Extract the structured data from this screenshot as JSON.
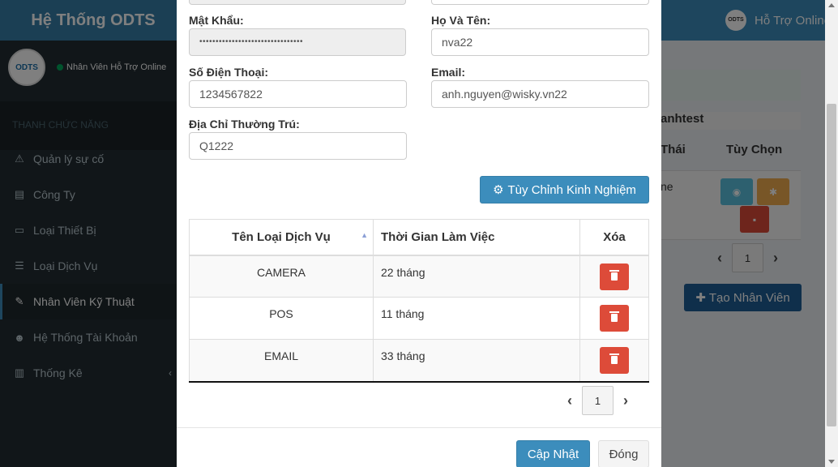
{
  "app": {
    "logo": "Hệ Thống ODTS",
    "help_online": "Hỗ Trợ Online",
    "help_avatar_text": "ODTS",
    "user_status": "Nhân Viên Hỗ Trợ Online",
    "user_avatar_text": "ODTS"
  },
  "sidebar": {
    "header": "THANH CHỨC NĂNG",
    "items": [
      {
        "label": "Quản lý sự cố",
        "icon": "warning-icon"
      },
      {
        "label": "Công Ty",
        "icon": "building-icon"
      },
      {
        "label": "Loại Thiết Bị",
        "icon": "desktop-icon"
      },
      {
        "label": "Loại Dịch Vụ",
        "icon": "list-icon"
      },
      {
        "label": "Nhân Viên Kỹ Thuật",
        "icon": "wrench-icon",
        "active": true
      },
      {
        "label": "Hệ Thống Tài Khoản",
        "icon": "users-icon"
      },
      {
        "label": "Thống Kê",
        "icon": "bar-chart-icon"
      }
    ]
  },
  "background": {
    "table_title": "anhtest",
    "th_status": "Thái",
    "th_options": "Tùy Chọn",
    "cell_status": "ne",
    "page": "1",
    "create_button": "Tạo Nhân Viên"
  },
  "form": {
    "password_label": "Mật Khẩu:",
    "password_value": "••••••••••••••••••••••••••••••••",
    "fullname_label": "Họ Và Tên:",
    "fullname_value": "nva22",
    "phone_label": "Số Điện Thoại:",
    "phone_value": "1234567822",
    "email_label": "Email:",
    "email_value": "anh.nguyen@wisky.vn22",
    "address_label": "Địa Chỉ Thường Trú:",
    "address_value": "Q1222",
    "custom_exp_button": "Tùy Chỉnh Kinh Nghiệm"
  },
  "service_table": {
    "headers": {
      "name": "Tên Loại Dịch Vụ",
      "time": "Thời Gian Làm Việc",
      "delete": "Xóa"
    },
    "rows": [
      {
        "name": "CAMERA",
        "time": "22 tháng"
      },
      {
        "name": "POS",
        "time": "11 tháng"
      },
      {
        "name": "EMAIL",
        "time": "33 tháng"
      }
    ],
    "page": "1"
  },
  "footer": {
    "update_button": "Cập Nhật",
    "close_button": "Đóng"
  },
  "colors": {
    "primary": "#3c8dbc",
    "danger": "#dd4b39",
    "sidebar_bg": "#222d32"
  }
}
